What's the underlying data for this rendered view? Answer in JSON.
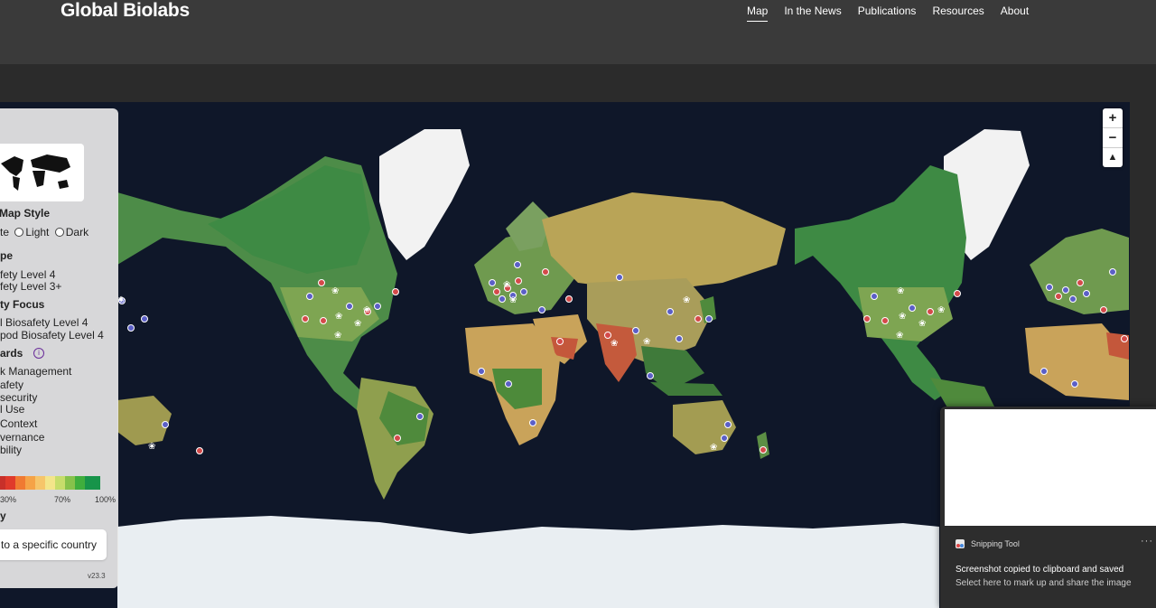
{
  "header": {
    "title": "Global Biolabs",
    "nav": [
      {
        "label": "Map",
        "active": true
      },
      {
        "label": "In the News",
        "active": false
      },
      {
        "label": "Publications",
        "active": false
      },
      {
        "label": "Resources",
        "active": false
      },
      {
        "label": "About",
        "active": false
      }
    ]
  },
  "map": {
    "zoom_in": "+",
    "zoom_out": "−",
    "reset_north": "▲"
  },
  "panel": {
    "map_style_heading": "Map Style",
    "map_style_options": [
      "te",
      "Light",
      "Dark"
    ],
    "type_heading": "pe",
    "type_items": [
      "fety Level 4",
      "fety Level 3+"
    ],
    "focus_heading": "ty Focus",
    "focus_items": [
      "l Biosafety Level 4",
      "pod Biosafety Level 4"
    ],
    "standards_heading": "ards",
    "info_icon": "i",
    "standards_items": [
      "k Management",
      "afety",
      "security",
      "l Use",
      " Context",
      "vernance",
      "bility"
    ],
    "scale_labels": [
      "30%",
      "70%",
      "100%"
    ],
    "scale_colors": [
      "#e03a2b",
      "#f07a32",
      "#f5a347",
      "#f6c56a",
      "#f3e58a",
      "#c6dd6b",
      "#86c24b",
      "#3fae3d",
      "#17944a"
    ],
    "country_heading": "y",
    "country_placeholder": "to a specific country",
    "version": "v23.3"
  },
  "notification": {
    "app_name": "Snipping Tool",
    "more": "···",
    "message_title": "Screenshot copied to clipboard and saved",
    "message_sub": "Select here to mark up and share the image"
  },
  "colors": {
    "header_bg": "#3a3a3a",
    "ocean": "#0f1729",
    "marker_blue": "#5b5fc7",
    "marker_red": "#d44a4a"
  }
}
